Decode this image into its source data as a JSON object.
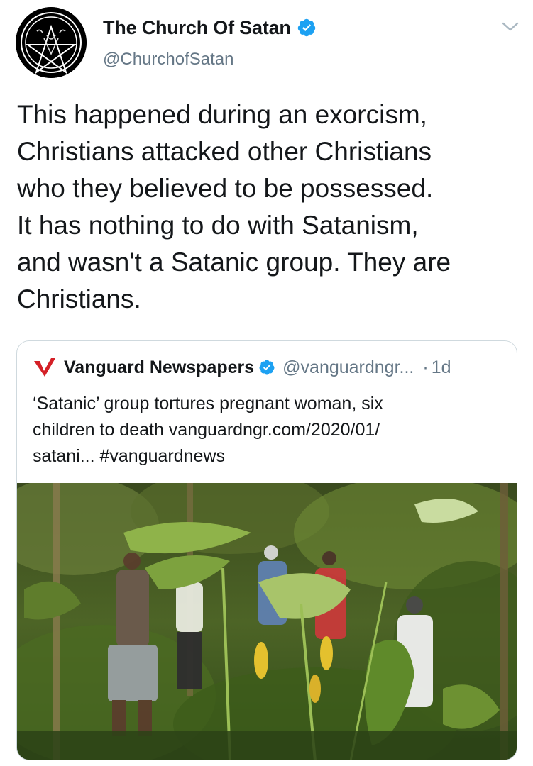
{
  "tweet": {
    "display_name": "The Church Of Satan",
    "handle": "@ChurchofSatan",
    "text": "This happened during an exorcism,\nChristians attacked other Christians\nwho they believed to be possessed.\nIt has nothing to do with Satanism,\nand wasn't a Satanic group. They are\nChristians.",
    "verified": true,
    "avatar_icon": "baphomet-sigil-icon",
    "menu_icon": "chevron-down-icon"
  },
  "quoted_tweet": {
    "display_name": "Vanguard Newspapers",
    "handle": "@vanguardngr...",
    "separator": "·",
    "time": "1d",
    "verified": true,
    "logo_icon": "vanguard-v-logo-icon",
    "text": "‘Satanic’ group tortures pregnant woman, six\nchildren to death vanguardngr.com/2020/01/\nsatani... #vanguardnews",
    "image_description_icon": "jungle-photo"
  },
  "colors": {
    "verified_blue": "#1da1f2",
    "secondary_text": "#657786",
    "primary_text": "#14171a",
    "border": "#cfd9de",
    "vanguard_red": "#d42027"
  }
}
